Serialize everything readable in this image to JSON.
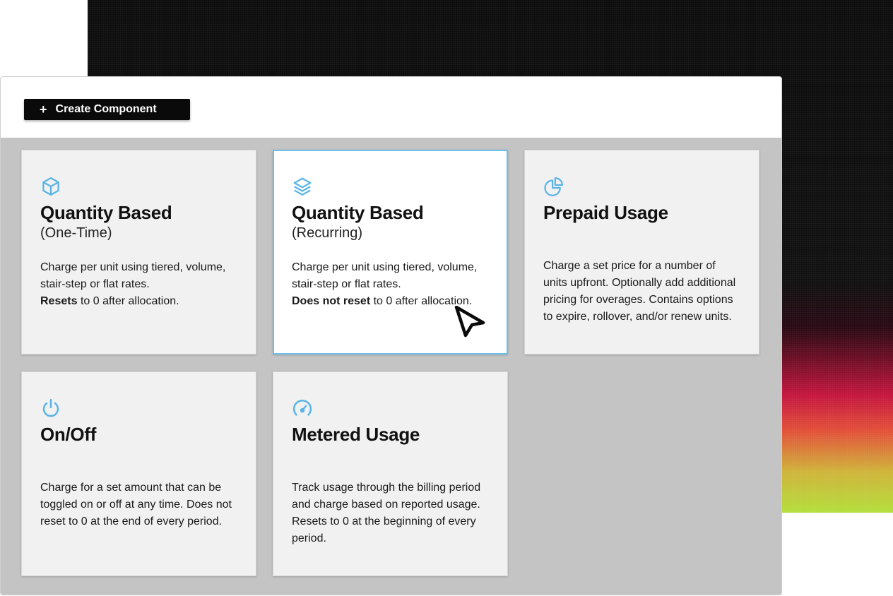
{
  "toolbar": {
    "create_button": {
      "icon": "plus-icon",
      "label": "Create Component"
    }
  },
  "accent_color": "#6cc0ea",
  "selected_card": "quantity-recurring",
  "cards": [
    {
      "id": "quantity-one-time",
      "icon": "box-icon",
      "title": "Quantity Based",
      "subtitle": "(One-Time)",
      "desc_text": "Charge per unit using tiered, volume, stair-step or flat rates.",
      "desc_bold": "Resets",
      "desc_tail": "to 0 after allocation."
    },
    {
      "id": "quantity-recurring",
      "icon": "layers-icon",
      "title": "Quantity Based",
      "subtitle": "(Recurring)",
      "desc_text": "Charge per unit using tiered, volume, stair-step or flat rates.",
      "desc_bold": "Does not reset",
      "desc_tail": "to 0 after allocation."
    },
    {
      "id": "prepaid-usage",
      "icon": "pie-chart-icon",
      "title": "Prepaid Usage",
      "desc_text": "Charge a set price for a number of units upfront. Optionally add additional pricing for overages. Contains options to expire, rollover, and/or renew units."
    },
    {
      "id": "on-off",
      "icon": "power-icon",
      "title": "On/Off",
      "desc_text": "Charge for a set amount that can be toggled on or off at any time. Does not reset to 0 at the end of every period."
    },
    {
      "id": "metered-usage",
      "icon": "gauge-icon",
      "title": "Metered Usage",
      "desc_text": "Track usage through the billing period and charge based on reported usage. Resets to 0 at the beginning of every period."
    }
  ],
  "cursor_icon": "mouse-pointer-icon"
}
